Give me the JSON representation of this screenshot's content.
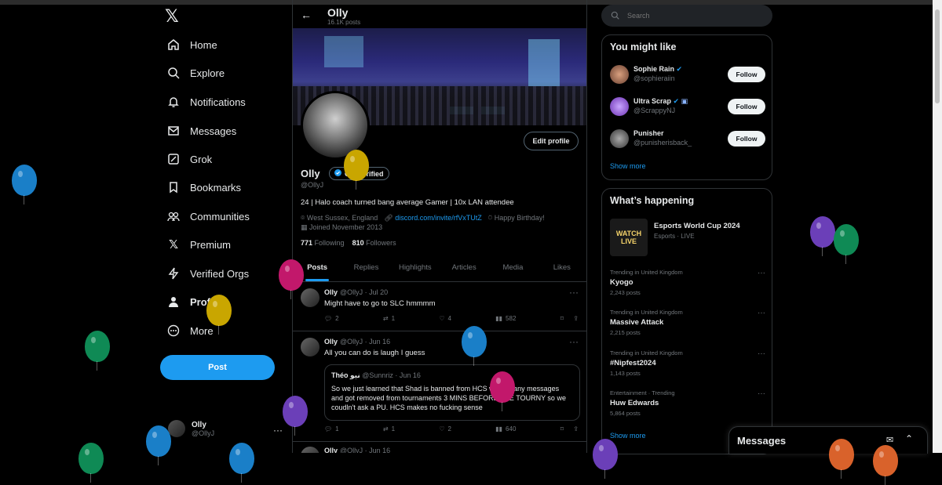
{
  "nav": {
    "items": [
      {
        "label": "Home",
        "icon": "home-icon"
      },
      {
        "label": "Explore",
        "icon": "search-icon"
      },
      {
        "label": "Notifications",
        "icon": "bell-icon"
      },
      {
        "label": "Messages",
        "icon": "mail-icon"
      },
      {
        "label": "Grok",
        "icon": "grok-icon"
      },
      {
        "label": "Bookmarks",
        "icon": "bookmark-icon"
      },
      {
        "label": "Communities",
        "icon": "communities-icon"
      },
      {
        "label": "Premium",
        "icon": "x-icon"
      },
      {
        "label": "Verified Orgs",
        "icon": "bolt-icon"
      },
      {
        "label": "Profile",
        "icon": "person-icon"
      },
      {
        "label": "More",
        "icon": "more-circle-icon"
      }
    ],
    "post_label": "Post",
    "me": {
      "name": "Olly",
      "handle": "@OllyJ"
    }
  },
  "header": {
    "name": "Olly",
    "posts": "16.1K posts"
  },
  "profile": {
    "name": "Olly",
    "get_verified": "Get verified",
    "handle": "@OllyJ",
    "bio": "24 | Halo coach turned bang average Gamer | 10x LAN attendee",
    "location": "West Sussex, England",
    "link": "discord.com/invite/rfVxTUtZ",
    "birthday": "Happy Birthday!",
    "joined": "Joined November 2013",
    "following_count": "771",
    "following_label": "Following",
    "followers_count": "810",
    "followers_label": "Followers",
    "edit_profile": "Edit profile"
  },
  "tabs": [
    "Posts",
    "Replies",
    "Highlights",
    "Articles",
    "Media",
    "Likes"
  ],
  "tweets": [
    {
      "name": "Olly",
      "handle": "@OllyJ",
      "date": "Jul 20",
      "text": "Might have to go to SLC hmmmm",
      "replies": "2",
      "reposts": "1",
      "likes": "4",
      "views": "582"
    },
    {
      "name": "Olly",
      "handle": "@OllyJ",
      "date": "Jun 16",
      "text": "All you can do is laugh I guess",
      "quote": {
        "name": "Théo نيو",
        "handle": "@Sunnriz",
        "date": "Jun 16",
        "text": "So we just learned that Shad is banned from HCS without any messages and got removed from tournaments 3 MINS BEFORE THE TOURNY so we coudln't ask a PU. HCS makes no fucking sense"
      },
      "replies": "1",
      "reposts": "1",
      "likes": "2",
      "views": "640"
    },
    {
      "name": "Olly",
      "handle": "@OllyJ",
      "date": "Jun 16"
    }
  ],
  "search": {
    "placeholder": "Search"
  },
  "might_like": {
    "title": "You might like",
    "users": [
      {
        "name": "Sophie Rain",
        "handle": "@sophieraiin",
        "follow": "Follow"
      },
      {
        "name": "Ultra Scrap",
        "handle": "@ScrappyNJ",
        "follow": "Follow"
      },
      {
        "name": "Punisher",
        "handle": "@punisherisback_",
        "follow": "Follow"
      }
    ],
    "show_more": "Show more"
  },
  "happening": {
    "title": "What’s happening",
    "event": {
      "title": "Esports World Cup 2024",
      "sub": "Esports · LIVE",
      "thumb_line1": "WATCH",
      "thumb_line2": "LIVE"
    },
    "trends": [
      {
        "ctx": "Trending in United Kingdom",
        "topic": "Kyogo",
        "count": "2,243 posts"
      },
      {
        "ctx": "Trending in United Kingdom",
        "topic": "Massive Attack",
        "count": "2,215 posts"
      },
      {
        "ctx": "Trending in United Kingdom",
        "topic": "#Nipfest2024",
        "count": "1,143 posts"
      },
      {
        "ctx": "Entertainment · Trending",
        "topic": "Huw Edwards",
        "count": "5,864 posts"
      }
    ],
    "show_more": "Show more"
  },
  "messages_drawer": {
    "title": "Messages"
  },
  "colors": {
    "accent": "#1d9bf0",
    "background": "#000000",
    "border": "#2f3336"
  }
}
